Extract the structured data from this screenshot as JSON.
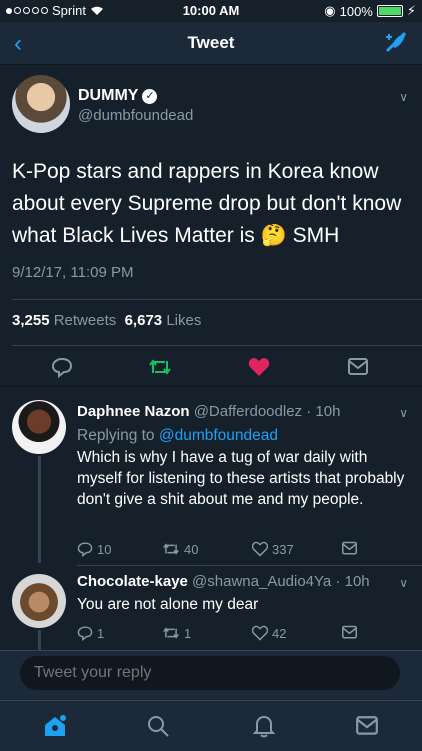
{
  "status": {
    "carrier": "Sprint",
    "time": "10:00 AM",
    "battery": "100%"
  },
  "nav": {
    "title": "Tweet"
  },
  "main_tweet": {
    "name": "DUMMY",
    "handle": "@dumbfoundead",
    "text": "K-Pop stars and rappers in Korea know about every Supreme drop but don't know what Black Lives Matter is 🤔 SMH",
    "timestamp": "9/12/17, 11:09 PM",
    "retweets": "3,255",
    "retweets_label": "Retweets",
    "likes": "6,673",
    "likes_label": "Likes"
  },
  "replies": [
    {
      "name": "Daphnee Nazon",
      "handle": "@Dafferdoodlez",
      "time": "· 10h",
      "replying_prefix": "Replying to",
      "replying_to": "@dumbfoundead",
      "text": "Which is why I have a tug of war daily with myself for listening to these artists that probably don't give a shit about me and my people.",
      "replies": "10",
      "retweets": "40",
      "likes": "337"
    },
    {
      "name": "Chocolate-kaye",
      "handle": "@shawna_Audio4Ya",
      "time": "· 10h",
      "text": "You are not alone my dear",
      "replies": "1",
      "retweets": "1",
      "likes": "42"
    }
  ],
  "reply_box": {
    "placeholder": "Tweet your reply"
  },
  "colors": {
    "accent": "#1da1f2",
    "like": "#e0245e",
    "retweet": "#17bf63",
    "background": "#15202b"
  }
}
